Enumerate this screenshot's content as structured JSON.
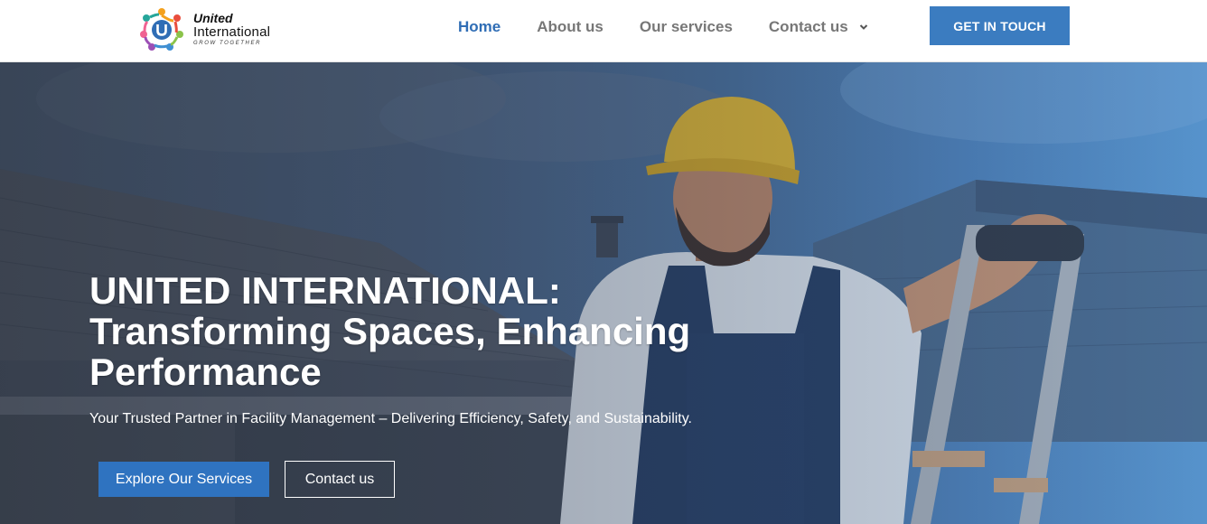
{
  "brand": {
    "name_line1": "United",
    "name_line2": "International",
    "tagline": "GROW TOGETHER",
    "colors": {
      "primary": "#3b7cc0",
      "nav_active": "#2f6db5",
      "nav_text": "#777777"
    }
  },
  "nav": {
    "items": [
      {
        "label": "Home",
        "active": true
      },
      {
        "label": "About us",
        "active": false
      },
      {
        "label": "Our services",
        "active": false
      },
      {
        "label": "Contact us",
        "active": false,
        "has_dropdown": true,
        "icon": "chevron-down-icon"
      }
    ],
    "cta_label": "GET IN TOUCH"
  },
  "hero": {
    "title_line1": "UNITED INTERNATIONAL:",
    "title_line2": "Transforming Spaces, Enhancing",
    "title_line3": "Performance",
    "subtitle": "Your Trusted Partner in Facility Management – Delivering Efficiency, Safety, and Sustainability.",
    "primary_button": "Explore Our Services",
    "secondary_button": "Contact us"
  }
}
